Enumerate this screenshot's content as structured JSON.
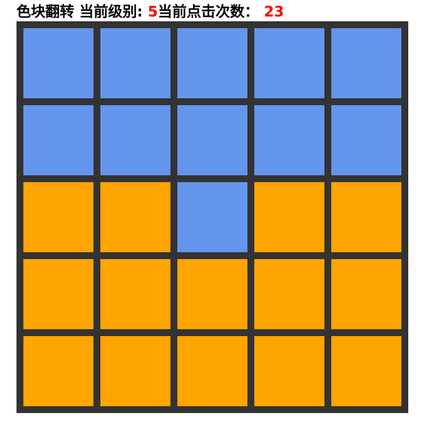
{
  "header": {
    "title": "色块翻转",
    "level_label": "当前级别:",
    "level_value": "5",
    "clicks_label": "当前点击次数：",
    "clicks_value": "23"
  },
  "colors": {
    "blue": "#6495ed",
    "orange": "#ffa500",
    "border": "#333333",
    "highlight": "#ff0000"
  },
  "board": {
    "size": 5,
    "cells": [
      [
        "blue",
        "blue",
        "blue",
        "blue",
        "blue"
      ],
      [
        "blue",
        "blue",
        "blue",
        "blue",
        "blue"
      ],
      [
        "orange",
        "orange",
        "blue",
        "orange",
        "orange"
      ],
      [
        "orange",
        "orange",
        "orange",
        "orange",
        "orange"
      ],
      [
        "orange",
        "orange",
        "orange",
        "orange",
        "orange"
      ]
    ]
  }
}
